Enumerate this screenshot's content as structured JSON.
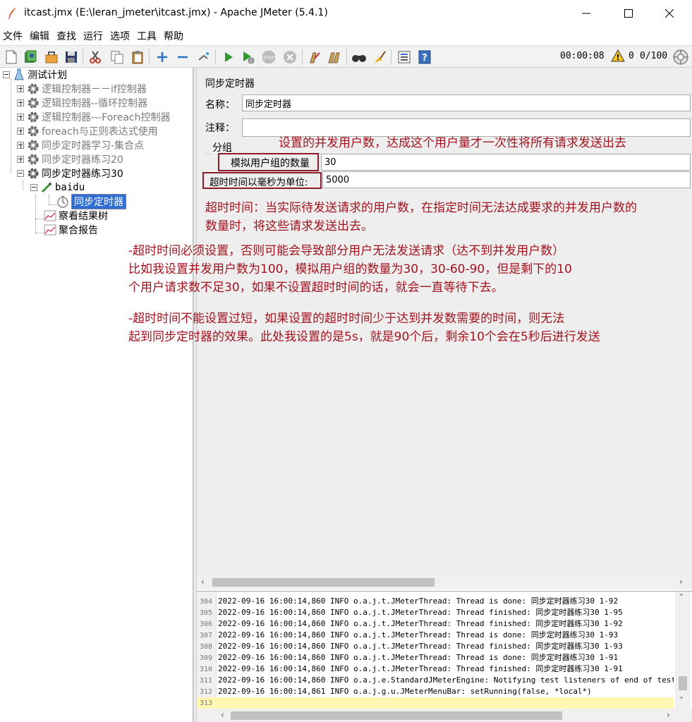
{
  "window": {
    "title": "itcast.jmx (E:\\leran_jmeter\\itcast.jmx) - Apache JMeter (5.4.1)"
  },
  "menu": [
    "文件",
    "编辑",
    "查找",
    "运行",
    "选项",
    "工具",
    "帮助"
  ],
  "toolbar": {
    "timer": "00:00:08",
    "warning_count": "0",
    "threads": "0/100",
    "buttons": [
      "new-icon",
      "templates-icon",
      "open-icon",
      "save-icon",
      "cut-icon",
      "copy-icon",
      "paste-icon",
      "expand-icon",
      "collapse-icon",
      "toggle-icon",
      "start-icon",
      "start-no-pause-icon",
      "stop-icon",
      "shutdown-icon",
      "clear-icon",
      "clear-all-icon",
      "search-icon",
      "reset-search-icon",
      "function-helper-icon",
      "help-icon"
    ]
  },
  "tree": {
    "root": "测试计划",
    "items": [
      {
        "label": "逻辑控制器－－if控制器"
      },
      {
        "label": "逻辑控制器--循环控制器"
      },
      {
        "label": "逻辑控制器---Foreach控制器"
      },
      {
        "label": "foreach与正则表达式使用"
      },
      {
        "label": "同步定时器学习-集合点"
      },
      {
        "label": "同步定时器练习20"
      },
      {
        "label": "同步定时器练习30"
      }
    ],
    "sampler": "baidu",
    "selected": "同步定时器",
    "listeners": [
      "察看结果树",
      "聚合报告"
    ]
  },
  "panel": {
    "title": "同步定时器",
    "name_label": "名称：",
    "name_value": "同步定时器",
    "comment_label": "注释：",
    "comment_value": "",
    "group_label": "分组",
    "group_size_label": "模拟用户组的数量",
    "group_size_value": "30",
    "timeout_label": "超时时间以毫秒为单位:",
    "timeout_value": "5000"
  },
  "annotations": {
    "a1": "设置的并发用户数，达成这个用户量才一次性将所有请求发送出去",
    "a2_l1": "超时时间：当实际待发送请求的用户数，在指定时间无法达成要求的并发用户数的",
    "a2_l2": "数量时，将这些请求发送出去。",
    "a3_l1": "-超时时间必须设置，否则可能会导致部分用户无法发送请求（达不到并发用户数）",
    "a3_l2": "比如我设置并发用户数为100，模拟用户组的数量为30，30-60-90，但是剩下的10",
    "a3_l3": "个用户请求数不足30，如果不设置超时时间的话，就会一直等待下去。",
    "a4_l1": "-超时时间不能设置过短，如果设置的超时时间少于达到并发数需要的时间，则无法",
    "a4_l2": "起到同步定时器的效果。此处我设置的是5s，就是90个后，剩余10个会在5秒后进行发送"
  },
  "log": [
    {
      "n": "304",
      "text": "2022-09-16 16:00:14,860 INFO o.a.j.t.JMeterThread: Thread is done: 同步定时器练习30 1-92"
    },
    {
      "n": "305",
      "text": "2022-09-16 16:00:14,860 INFO o.a.j.t.JMeterThread: Thread finished: 同步定时器练习30 1-95"
    },
    {
      "n": "306",
      "text": "2022-09-16 16:00:14,860 INFO o.a.j.t.JMeterThread: Thread finished: 同步定时器练习30 1-92"
    },
    {
      "n": "307",
      "text": "2022-09-16 16:00:14,860 INFO o.a.j.t.JMeterThread: Thread is done: 同步定时器练习30 1-93"
    },
    {
      "n": "308",
      "text": "2022-09-16 16:00:14,860 INFO o.a.j.t.JMeterThread: Thread finished: 同步定时器练习30 1-93"
    },
    {
      "n": "309",
      "text": "2022-09-16 16:00:14,860 INFO o.a.j.t.JMeterThread: Thread is done: 同步定时器练习30 1-91"
    },
    {
      "n": "310",
      "text": "2022-09-16 16:00:14,860 INFO o.a.j.t.JMeterThread: Thread finished: 同步定时器练习30 1-91"
    },
    {
      "n": "311",
      "text": "2022-09-16 16:00:14,860 INFO o.a.j.e.StandardJMeterEngine: Notifying test listeners of end of test"
    },
    {
      "n": "312",
      "text": "2022-09-16 16:00:14,861 INFO o.a.j.g.u.JMeterMenuBar: setRunning(false, *local*)"
    },
    {
      "n": "313",
      "text": ""
    }
  ]
}
